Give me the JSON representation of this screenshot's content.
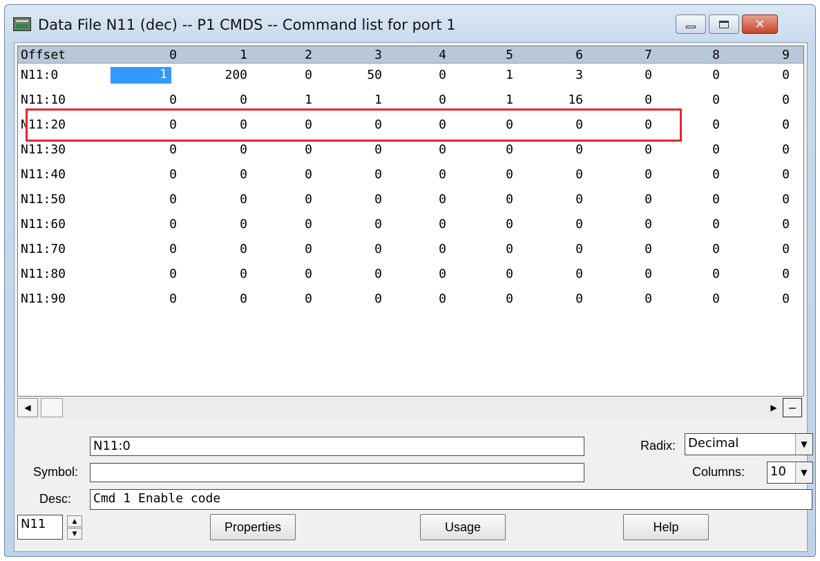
{
  "window": {
    "title": "Data File N11 (dec) -- P1 CMDS -- Command list for port 1"
  },
  "grid": {
    "header": [
      "Offset",
      "0",
      "1",
      "2",
      "3",
      "4",
      "5",
      "6",
      "7",
      "8",
      "9"
    ],
    "rows": [
      {
        "label": "N11:0",
        "values": [
          "1",
          "200",
          "0",
          "50",
          "0",
          "1",
          "3",
          "0",
          "0",
          "0"
        ]
      },
      {
        "label": "N11:10",
        "values": [
          "0",
          "0",
          "1",
          "1",
          "0",
          "1",
          "16",
          "0",
          "0",
          "0"
        ]
      },
      {
        "label": "N11:20",
        "values": [
          "0",
          "0",
          "0",
          "0",
          "0",
          "0",
          "0",
          "0",
          "0",
          "0"
        ]
      },
      {
        "label": "N11:30",
        "values": [
          "0",
          "0",
          "0",
          "0",
          "0",
          "0",
          "0",
          "0",
          "0",
          "0"
        ]
      },
      {
        "label": "N11:40",
        "values": [
          "0",
          "0",
          "0",
          "0",
          "0",
          "0",
          "0",
          "0",
          "0",
          "0"
        ]
      },
      {
        "label": "N11:50",
        "values": [
          "0",
          "0",
          "0",
          "0",
          "0",
          "0",
          "0",
          "0",
          "0",
          "0"
        ]
      },
      {
        "label": "N11:60",
        "values": [
          "0",
          "0",
          "0",
          "0",
          "0",
          "0",
          "0",
          "0",
          "0",
          "0"
        ]
      },
      {
        "label": "N11:70",
        "values": [
          "0",
          "0",
          "0",
          "0",
          "0",
          "0",
          "0",
          "0",
          "0",
          "0"
        ]
      },
      {
        "label": "N11:80",
        "values": [
          "0",
          "0",
          "0",
          "0",
          "0",
          "0",
          "0",
          "0",
          "0",
          "0"
        ]
      },
      {
        "label": "N11:90",
        "values": [
          "0",
          "0",
          "0",
          "0",
          "0",
          "0",
          "0",
          "0",
          "0",
          "0"
        ]
      }
    ],
    "selected_cell": "N11:0",
    "highlight_color": "#e3262b",
    "selection_color": "#3399ff"
  },
  "form": {
    "address_value": "N11:0",
    "symbol_label": "Symbol:",
    "symbol_value": "",
    "desc_label": "Desc:",
    "desc_value": "Cmd 1 Enable code",
    "radix_label": "Radix:",
    "radix_value": "Decimal",
    "columns_label": "Columns:",
    "columns_value": "10",
    "file_value": "N11"
  },
  "buttons": {
    "properties": "Properties",
    "usage": "Usage",
    "help": "Help"
  }
}
